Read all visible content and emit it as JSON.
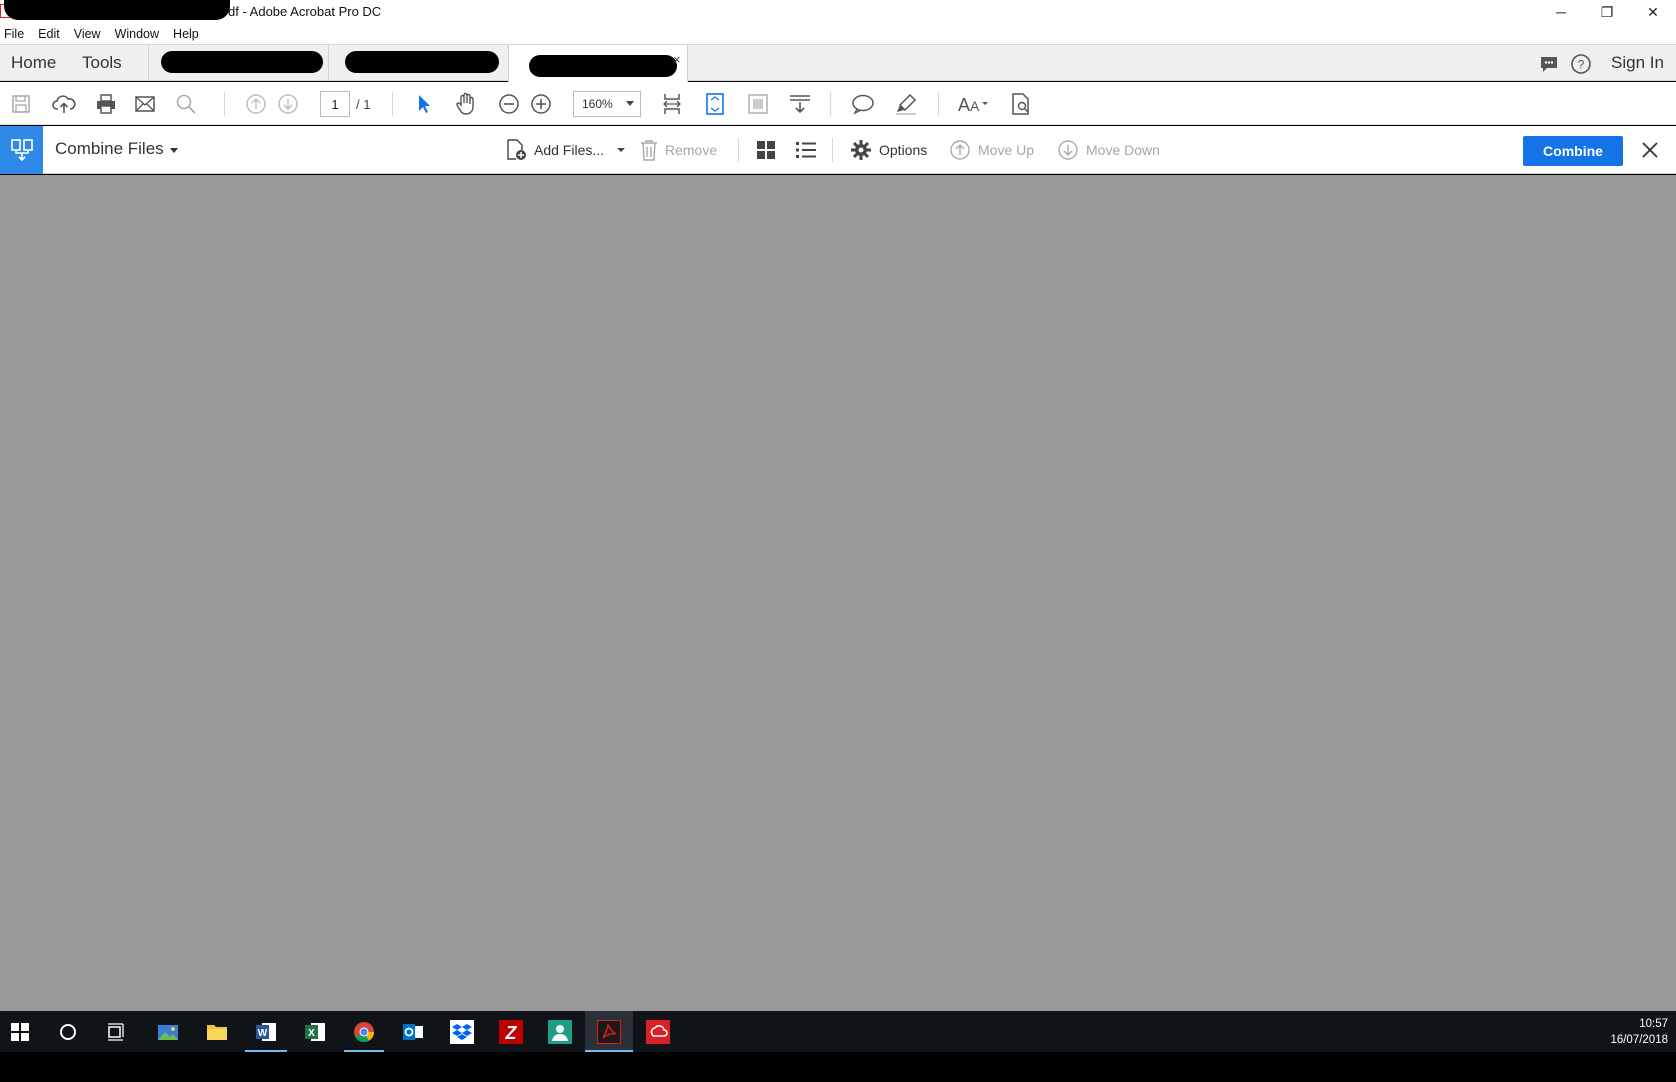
{
  "window": {
    "title": "df - Adobe Acrobat Pro DC",
    "minimize": "─",
    "restore": "❐",
    "close": "✕"
  },
  "menu": {
    "items": [
      "File",
      "Edit",
      "View",
      "Window",
      "Help"
    ]
  },
  "tabs": {
    "home": "Home",
    "tools": "Tools",
    "doc_tab_close": "×",
    "sign_in": "Sign In"
  },
  "toolbar": {
    "page_current": "1",
    "page_total": "/ 1",
    "zoom": "160%"
  },
  "combine": {
    "title": "Combine Files",
    "add_files": "Add Files...",
    "remove": "Remove",
    "options": "Options",
    "move_up": "Move Up",
    "move_down": "Move Down",
    "combine_button": "Combine"
  },
  "taskbar": {
    "time": "10:57",
    "date": "16/07/2018"
  },
  "colors": {
    "accent": "#1473e6",
    "tool_icon_bg": "#2e8ae6",
    "workspace_bg": "#999999",
    "taskbar_bg": "#101418"
  }
}
